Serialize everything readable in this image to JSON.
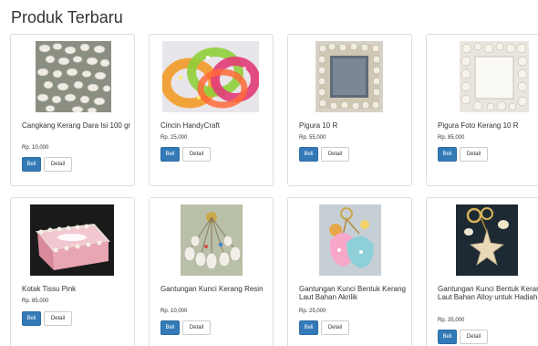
{
  "page": {
    "title": "Produk Terbaru"
  },
  "products": [
    {
      "name": "Cangkang Kerang Dara Isi 100 gr",
      "price": "Rp. 10,000",
      "buy_label": "Beli",
      "detail_label": "Detail",
      "image": "white-shells-photo"
    },
    {
      "name": "Cincin HandyCraft",
      "price": "Rp. 25,000",
      "buy_label": "Beli",
      "detail_label": "Detail",
      "image": "resin-bangles-photo"
    },
    {
      "name": "Pigura 10 R",
      "price": "Rp. 55,000",
      "buy_label": "Beli",
      "detail_label": "Detail",
      "image": "shell-frame-photo"
    },
    {
      "name": "Pigura Foto Kerang 10 R",
      "price": "Rp. 85,000",
      "buy_label": "Beli",
      "detail_label": "Detail",
      "image": "shell-photo-frame-photo"
    },
    {
      "name": "Kotak Tissu Pink",
      "price": "Rp. 85,000",
      "buy_label": "Beli",
      "detail_label": "Detail",
      "image": "pink-tissue-box-photo"
    },
    {
      "name": "Gantungan Kunci Kerang Resin",
      "price": "Rp. 10,000",
      "buy_label": "Beli",
      "detail_label": "Detail",
      "image": "resin-keychains-photo"
    },
    {
      "name": "Gantungan Kunci Bentuk Kerang Laut Bahan Akrilik",
      "price": "Rp. 25,000",
      "buy_label": "Beli",
      "detail_label": "Detail",
      "image": "acrylic-shell-keychain-photo"
    },
    {
      "name": "Gantungan Kunci Bentuk Kerang Laut Bahan Alloy untuk Hadiah",
      "price": "Rp. 35,000",
      "buy_label": "Beli",
      "detail_label": "Detail",
      "image": "starfish-keychain-photo"
    }
  ],
  "colors": {
    "primary": "#337ab7",
    "border": "#dddddd",
    "text": "#333333"
  }
}
